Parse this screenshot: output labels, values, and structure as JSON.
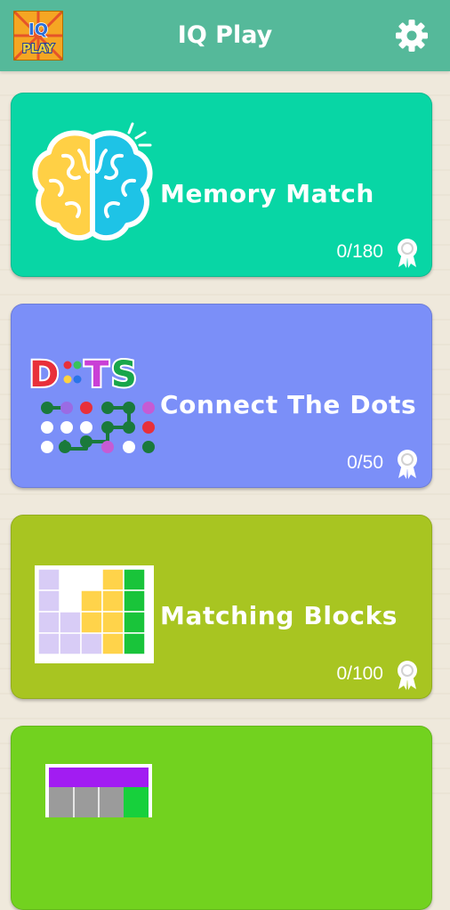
{
  "header": {
    "title": "IQ Play",
    "logo_text": [
      "IQ",
      "PLAY"
    ],
    "colors": {
      "bar": "#55b99a"
    }
  },
  "games": [
    {
      "title": "Memory Match",
      "score": "0/180",
      "color": "#08d6a5",
      "icon": "brain-icon",
      "badge_icon": "award-ribbon-icon"
    },
    {
      "title": "Connect The Dots",
      "score": "0/50",
      "color": "#7b8ff8",
      "icon": "dots-icon",
      "badge_icon": "award-ribbon-icon",
      "icon_text": "DOTS"
    },
    {
      "title": "Matching Blocks",
      "score": "0/100",
      "color": "#a8c521",
      "icon": "blocks-icon",
      "badge_icon": "award-ribbon-icon"
    },
    {
      "title": "",
      "score": "",
      "color": "#72d21f",
      "icon": "grid-icon"
    }
  ]
}
